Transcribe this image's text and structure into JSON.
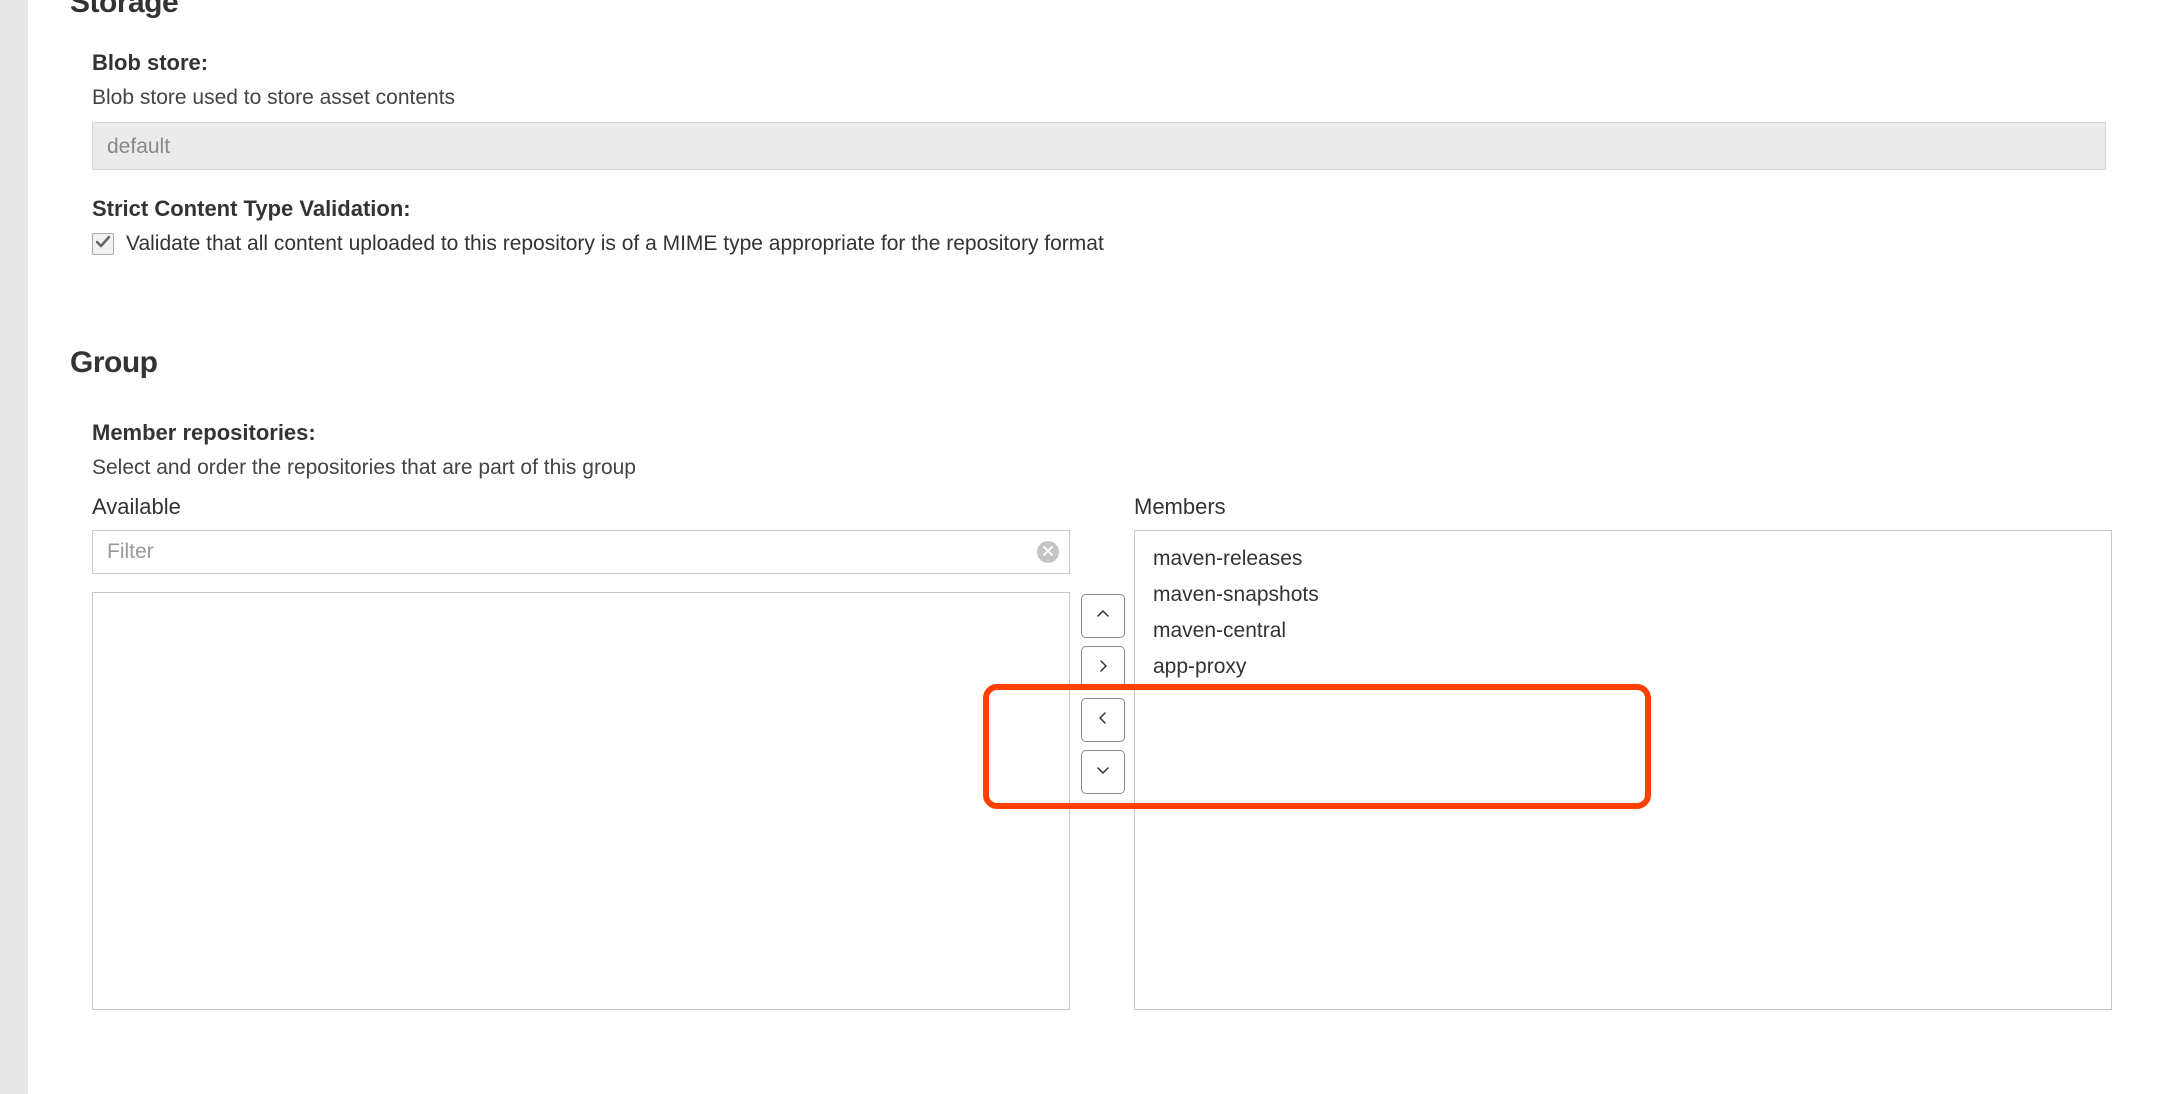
{
  "storage": {
    "section_title": "Storage",
    "blob_store": {
      "label": "Blob store:",
      "help": "Blob store used to store asset contents",
      "value": "default"
    },
    "strict_validation": {
      "label": "Strict Content Type Validation:",
      "checked": true,
      "text": "Validate that all content uploaded to this repository is of a MIME type appropriate for the repository format"
    }
  },
  "group": {
    "section_title": "Group",
    "member_repos": {
      "label": "Member repositories:",
      "help": "Select and order the repositories that are part of this group",
      "available_label": "Available",
      "members_label": "Members",
      "filter_placeholder": "Filter",
      "available": [],
      "members": [
        "maven-releases",
        "maven-snapshots",
        "maven-central",
        "app-proxy"
      ]
    }
  },
  "icons": {
    "clear": "clear-icon",
    "move_up": "chevron-up-icon",
    "add": "chevron-right-icon",
    "remove": "chevron-left-icon",
    "move_down": "chevron-down-icon",
    "check": "check-icon"
  }
}
